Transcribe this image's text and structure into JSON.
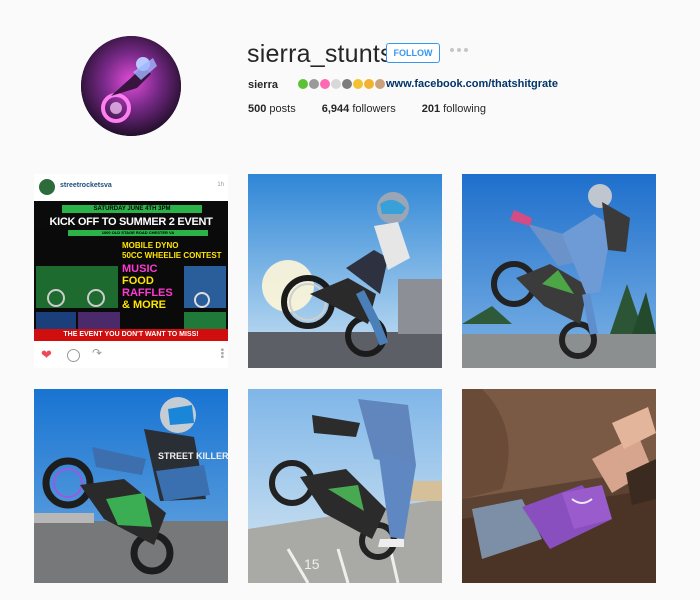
{
  "profile": {
    "username": "sierra_stunts",
    "follow_label": "FOLLOW",
    "full_name": "sierra",
    "bio_emojis": [
      "green-heart",
      "crossed-swords",
      "cupid-heart",
      "cross",
      "alien",
      "hands",
      "raised-hands",
      "crying-cat"
    ],
    "bio_link": "www.facebook.com/thatshitgrate",
    "stats": {
      "posts_count": "500",
      "posts_label": "posts",
      "followers_count": "6,944",
      "followers_label": "followers",
      "following_count": "201",
      "following_label": "following"
    }
  },
  "posts": [
    {
      "account": "streetrocketsva",
      "stamp": "1h",
      "flyer": {
        "date_line": "SATURDAY JUNE 4TH 3PM",
        "headline": "KICK OFF TO SUMMER 2 EVENT",
        "address": "1000 OLD STAGE ROAD CHESTER VA",
        "line1": "MOBILE DYNO",
        "line2": "50CC WHEELIE CONTEST",
        "line3": "MUSIC",
        "line4": "FOOD",
        "line5": "RAFFLES",
        "line6": "& MORE",
        "footer": "THE EVENT YOU DON'T WANT TO MISS!"
      }
    },
    {
      "subject": "rider-wheelie-sky"
    },
    {
      "subject": "rider-standing-wheelie"
    },
    {
      "subject": "rider-street-killers"
    },
    {
      "subject": "rider-wheelie-parking-lot"
    },
    {
      "subject": "rider-relaxing-couch"
    }
  ],
  "colors": {
    "accent": "#3897f0",
    "link": "#003569",
    "like": "#ed4956",
    "background": "#fafafa"
  }
}
